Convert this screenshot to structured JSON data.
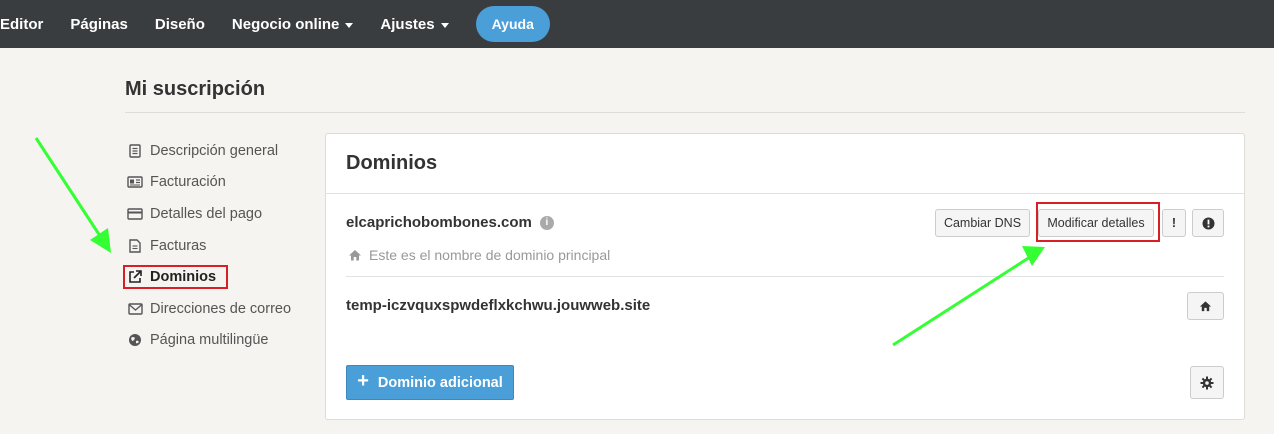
{
  "nav": {
    "items": [
      {
        "label": "Editor",
        "dropdown": false
      },
      {
        "label": "Páginas",
        "dropdown": false
      },
      {
        "label": "Diseño",
        "dropdown": false
      },
      {
        "label": "Negocio online",
        "dropdown": true
      },
      {
        "label": "Ajustes",
        "dropdown": true
      }
    ],
    "help_label": "Ayuda"
  },
  "page": {
    "title": "Mi suscripción"
  },
  "sidebar": {
    "items": [
      {
        "label": "Descripción general",
        "icon": "document-icon"
      },
      {
        "label": "Facturación",
        "icon": "id-card-icon"
      },
      {
        "label": "Detalles del pago",
        "icon": "credit-card-icon"
      },
      {
        "label": "Facturas",
        "icon": "file-icon"
      },
      {
        "label": "Dominios",
        "icon": "external-link-icon",
        "active": true
      },
      {
        "label": "Direcciones de correo",
        "icon": "envelope-icon"
      },
      {
        "label": "Página multilingüe",
        "icon": "globe-icon"
      }
    ]
  },
  "panel": {
    "title": "Dominios",
    "primary_domain": {
      "name": "elcaprichobombones.com",
      "note": "Este es el nombre de dominio principal",
      "btn_dns": "Cambiar DNS",
      "btn_modify": "Modificar detalles",
      "btn_excl": "!"
    },
    "secondary_domain": {
      "name": "temp-iczvquxspwdeflxkchwu.jouwweb.site"
    },
    "add_button": "Dominio adicional"
  },
  "colors": {
    "nav_bg": "#3a3d40",
    "accent": "#4a9fd8",
    "highlight": "#d71f26",
    "arrow": "#33ff33"
  }
}
